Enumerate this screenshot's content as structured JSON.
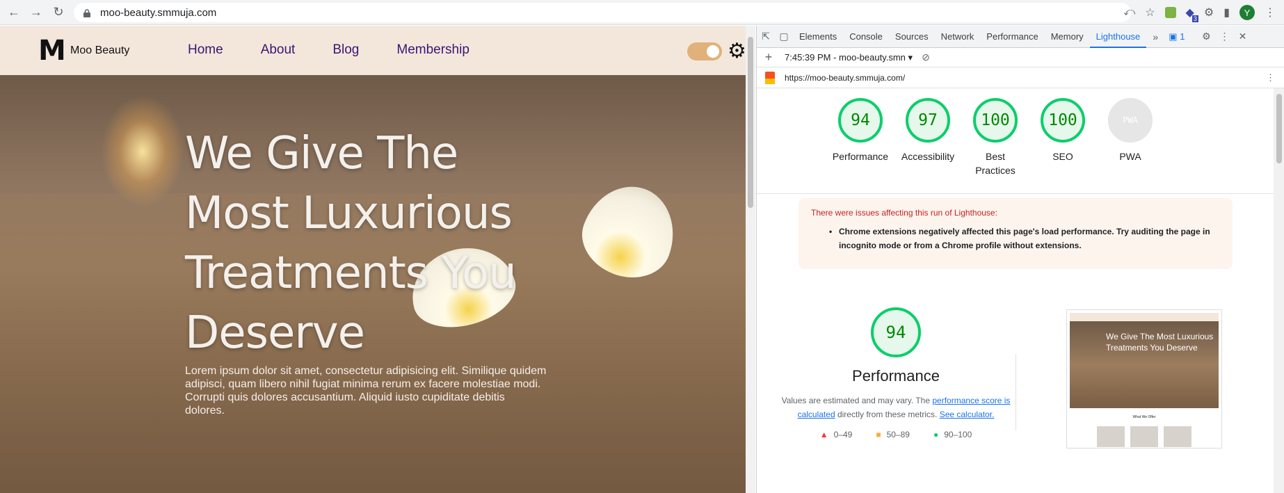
{
  "browser": {
    "url": "moo-beauty.smmuja.com",
    "avatar_letter": "Y",
    "extension_badge": "3"
  },
  "site": {
    "logo_letter": "M",
    "logo_text": "Moo Beauty",
    "nav": [
      {
        "label": "Home"
      },
      {
        "label": "About"
      },
      {
        "label": "Blog"
      },
      {
        "label": "Membership"
      }
    ],
    "hero_title": "We Give The Most Luxurious Treatments You Deserve",
    "hero_text": "Lorem ipsum dolor sit amet, consectetur adipisicing elit. Similique quidem adipisci, quam libero nihil fugiat minima rerum ex facere molestiae modi. Corrupti quis dolores accusantium. Aliquid iusto cupiditate debitis dolores."
  },
  "devtools": {
    "tabs": [
      "Elements",
      "Console",
      "Sources",
      "Network",
      "Performance",
      "Memory",
      "Lighthouse"
    ],
    "active_tab": "Lighthouse",
    "issues_count": "1",
    "report_label": "7:45:39 PM - moo-beauty.smn",
    "report_url": "https://moo-beauty.smmuja.com/",
    "scores": [
      {
        "value": "94",
        "label": "Performance"
      },
      {
        "value": "97",
        "label": "Accessibility"
      },
      {
        "value": "100",
        "label": "Best Practices"
      },
      {
        "value": "100",
        "label": "SEO"
      },
      {
        "value": "",
        "label": "PWA"
      }
    ],
    "pwa_badge": "PWA",
    "issues_head": "There were issues affecting this run of Lighthouse:",
    "issues_item": "Chrome extensions negatively affected this page's load performance. Try auditing the page in incognito mode or from a Chrome profile without extensions.",
    "perf_score": "94",
    "perf_title": "Performance",
    "perf_note_1": "Values are estimated and may vary. The",
    "perf_note_link": "performance score is calculated",
    "perf_note_2": "directly from these metrics.",
    "perf_note_link2": "See calculator.",
    "legend": [
      {
        "range": "0–49",
        "color": "#ff3333"
      },
      {
        "range": "50–89",
        "color": "#ffaa33"
      },
      {
        "range": "90–100",
        "color": "#0cce6b"
      }
    ],
    "thumb_title": "We Give The Most Luxurious Treatments You Deserve",
    "thumb_label": "What We Offer"
  },
  "colors": {
    "accent": "#1a73e8",
    "pass": "#0cce6b",
    "nav_text": "#3b1570",
    "header_bg": "#f3e7dc"
  }
}
